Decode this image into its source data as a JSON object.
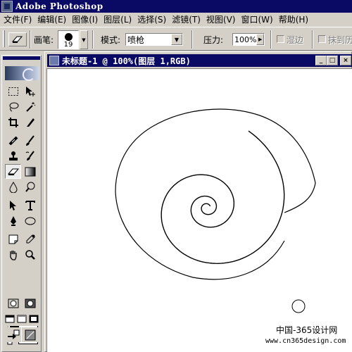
{
  "app": {
    "title": "Adobe Photoshop"
  },
  "menu": {
    "items": [
      "文件(F)",
      "编辑(E)",
      "图像(I)",
      "图层(L)",
      "选择(S)",
      "滤镜(T)",
      "视图(V)",
      "窗口(W)",
      "帮助(H)"
    ]
  },
  "options": {
    "brush_label": "画笔:",
    "brush_size": "19",
    "mode_label": "模式:",
    "mode_value": "喷枪",
    "pressure_label": "压力:",
    "pressure_value": "100%",
    "wet_edges_label": "湿边",
    "erase_history_label": "抹到历"
  },
  "document": {
    "title": "未标题-1 @ 100%(图层 1,RGB)"
  },
  "toolbox": {
    "active_tool": "eraser-tool",
    "foreground_color": "#000000",
    "background_color": "#ffffff"
  },
  "watermark": {
    "line1": "中国-365设计网",
    "line2": "www.cn365design.com"
  },
  "colors": {
    "titlebar": "#0a0a64",
    "chrome": "#d4d0c8",
    "canvas": "#ffffff"
  }
}
